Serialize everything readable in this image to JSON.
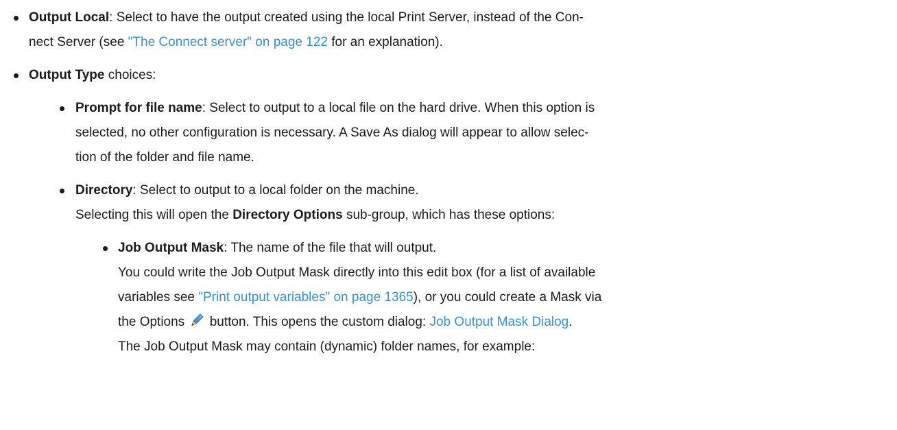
{
  "items": {
    "output_local": {
      "term": "Output Local",
      "line1": ": Select to have the output created using the local Print Server, instead of the Con-",
      "line2_pre": "nect Server (see ",
      "line2_link": "\"The Connect server\" on page 122",
      "line2_post": " for an explanation)."
    },
    "output_type": {
      "term": "Output Type",
      "rest": " choices:"
    },
    "prompt_for_file_name": {
      "term": "Prompt for file name",
      "line1": ": Select to output to a local file on the hard drive. When this option is",
      "line2": "selected, no other configuration is necessary. A Save As dialog will appear to allow selec-",
      "line3": "tion of the folder and file name."
    },
    "directory": {
      "term": "Directory",
      "line1": ": Select to output to a local folder on the machine.",
      "line2_pre": "Selecting this will open the ",
      "line2_bold": "Directory Options",
      "line2_post": " sub-group, which has these options:"
    },
    "job_output_mask": {
      "term": "Job Output Mask",
      "line1": ": The name of the file that will output.",
      "line2": "You could write the Job Output Mask directly into this edit box (for a list of available",
      "line3_pre": "variables see ",
      "line3_link": "\"Print output variables\" on page 1365",
      "line3_post": "), or you could create a Mask via",
      "line4_pre": "the Options ",
      "line4_mid": " button. This opens the custom dialog: ",
      "line4_link": "Job Output Mask Dialog",
      "line4_post": ".",
      "line5": "The Job Output Mask may contain (dynamic) folder names, for example:"
    }
  },
  "icons": {
    "options_button_icon": "pencil-icon"
  },
  "colors": {
    "link": "#3a8fd0",
    "text": "#1a1a1a"
  }
}
